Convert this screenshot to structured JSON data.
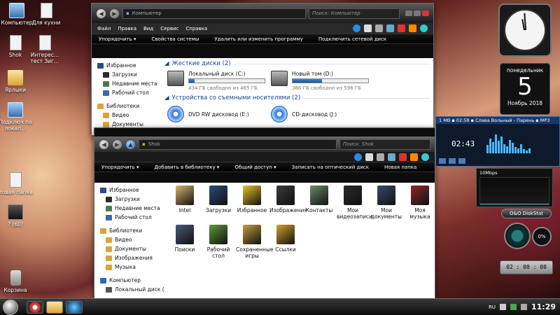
{
  "desktop_icons": [
    {
      "label": "Компьютер"
    },
    {
      "label": "Для кухни"
    },
    {
      "label": "Shok"
    },
    {
      "label": "Интерес… тест Зиг…"
    },
    {
      "label": "Ярлыки"
    },
    {
      "label": "Подключ по локал…"
    },
    {
      "label": "Новая папка"
    },
    {
      "label": "? (60)"
    },
    {
      "label": "Корзина"
    }
  ],
  "computer_window": {
    "address": "Компьютер",
    "search_placeholder": "Поиск: Компьютер",
    "menu": [
      "Файл",
      "Правка",
      "Вид",
      "Сервис",
      "Справка"
    ],
    "commands": [
      "Упорядочить ▾",
      "Свойства системы",
      "Удалить или изменить программу",
      "Подключить сетевой диск"
    ],
    "nav": {
      "favorites": "Избранное",
      "downloads": "Загрузки",
      "recent": "Недавние места",
      "desktop": "Рабочий стол",
      "libraries": "Библиотеки",
      "video": "Видео",
      "docs": "Документы"
    },
    "hdd_section": "Жесткие диски (2)",
    "drives": [
      {
        "name": "Локальный диск (C:)",
        "free": "434 ГБ свободно из 465 ГБ",
        "used_fraction": 0.07
      },
      {
        "name": "Новый том (D:)",
        "free": "366 ГБ свободно из 596 ГБ",
        "used_fraction": 0.39
      }
    ],
    "removable_section": "Устройства со съемными носителями (2)",
    "discs": [
      {
        "name": "DVD RW дисковод (E:)"
      },
      {
        "name": "CD-дисковод (J:)"
      }
    ]
  },
  "shok_window": {
    "address": "Shok",
    "search_placeholder": "Поиск: Shok",
    "commands": [
      "Упорядочить ▾",
      "Добавить в библиотеку ▾",
      "Общий доступ ▾",
      "Записать на оптический диск",
      "Новая папка"
    ],
    "nav": {
      "favorites": "Избранное",
      "downloads": "Загрузки",
      "recent": "Недавние места",
      "desktop": "Рабочий стол",
      "libraries": "Библиотеки",
      "video": "Видео",
      "docs": "Документы",
      "images": "Изображения",
      "music": "Музыка",
      "computer": "Компьютер",
      "local_disk": "Локальный диск ("
    },
    "items": [
      {
        "label": "Intel",
        "color": "#d9b36a"
      },
      {
        "label": "Загрузки",
        "color": "#2b4a7a"
      },
      {
        "label": "Избранное",
        "color": "#e8c030"
      },
      {
        "label": "Изображения",
        "color": "#3a3a3a"
      },
      {
        "label": "Контакты",
        "color": "#6a8a6a"
      },
      {
        "label": "Мои видеозаписи",
        "color": "#2a2a2a"
      },
      {
        "label": "Мои документы",
        "color": "#3a4a6a"
      },
      {
        "label": "Моя музыка",
        "color": "#8a2a2a"
      },
      {
        "label": "Поиски",
        "color": "#4a5a7a"
      },
      {
        "label": "Рабочий стол",
        "color": "#5a9a3a"
      },
      {
        "label": "Сохраненные игры",
        "color": "#c0a040"
      },
      {
        "label": "Ссылки",
        "color": "#d0a030"
      }
    ]
  },
  "gadgets": {
    "calendar_weekday": "понедельник",
    "calendar_day": "5",
    "calendar_month": "Ноябрь 2018",
    "player_title": "1 MB ▪ 02:58 ▪ Слава Вольный - Парень ▪ MP3",
    "player_time": "02:43",
    "net_label": "10Mbps",
    "oo_label": "O&O DiskStat",
    "oo_percent": "0%",
    "timer": "02 : 00 : 00"
  },
  "taskbar": {
    "lang": "RU",
    "clock": "11:29"
  }
}
